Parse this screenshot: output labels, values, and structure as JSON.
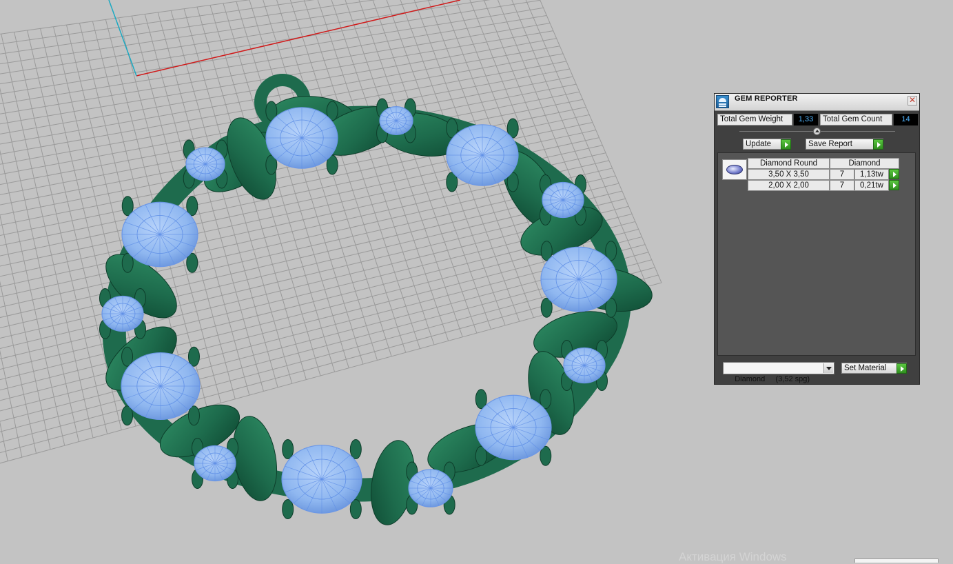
{
  "panel": {
    "title": "GEM REPORTER",
    "close_symbol": "✕",
    "total_gem_weight_label": "Total Gem Weight",
    "total_gem_weight_value": "1,33",
    "total_gem_count_label": "Total Gem Count",
    "total_gem_count_value": "14",
    "update_label": "Update",
    "save_report_label": "Save Report",
    "gem_group": {
      "thumbnail_icon": "diamond-round-icon",
      "shape_header": "Diamond Round",
      "material_header": "Diamond",
      "rows": [
        {
          "size": "3,50 X 3,50",
          "count": "7",
          "weight": "1,13tw"
        },
        {
          "size": "2,00 X 2,00",
          "count": "7",
          "weight": "0,21tw"
        }
      ]
    },
    "material_select_value": "Diamond     (3,52 spg)",
    "set_material_label": "Set Material"
  },
  "viewport": {
    "model_color": "#1e6b4d",
    "gem_color": "#9cc3f5",
    "grid_color": "#9a9a9a",
    "axis_x_color": "#d01a1a",
    "axis_z_color": "#1aa9c2"
  },
  "os": {
    "watermark": "Активация Windows"
  }
}
